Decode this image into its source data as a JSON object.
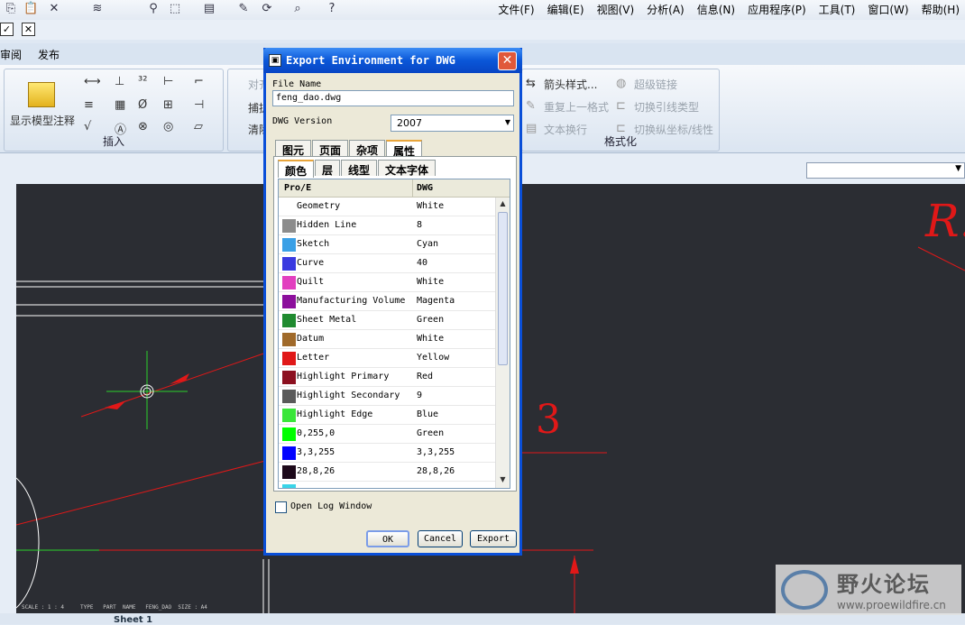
{
  "menubar": [
    "文件(F)",
    "编辑(E)",
    "视图(V)",
    "分析(A)",
    "信息(N)",
    "应用程序(P)",
    "工具(T)",
    "窗口(W)",
    "帮助(H)"
  ],
  "ribbon_tabs": [
    "审阅",
    "发布"
  ],
  "ribbon": {
    "big_button": "显示模型注释",
    "group_insert": "插入",
    "item_align": "对齐",
    "item_capture": "捕捉",
    "item_clear": "清除",
    "group_format": "格式化",
    "format_items": [
      "箭头样式...",
      "重复上一格式",
      "文本换行",
      "超级链接",
      "切换引线类型",
      "切换纵坐标/线性"
    ]
  },
  "dialog": {
    "title": "Export Environment for DWG",
    "file_name_label": "File Name",
    "file_name_value": "feng_dao.dwg",
    "dwg_version_label": "DWG Version",
    "dwg_version_value": "2007",
    "tabs": [
      "图元",
      "页面",
      "杂项",
      "属性"
    ],
    "active_tab": "属性",
    "subtabs": [
      "颜色",
      "层",
      "线型",
      "文本字体"
    ],
    "active_subtab": "颜色",
    "table_headers": [
      "Pro/E",
      "DWG"
    ],
    "rows": [
      {
        "name": "Geometry",
        "dwg": "White",
        "color": ""
      },
      {
        "name": "Hidden Line",
        "dwg": "8",
        "color": "#8c8c8c"
      },
      {
        "name": "Sketch",
        "dwg": "Cyan",
        "color": "#3aa0e6"
      },
      {
        "name": "Curve",
        "dwg": "40",
        "color": "#3a3ae0"
      },
      {
        "name": "Quilt",
        "dwg": "White",
        "color": "#e23fbf"
      },
      {
        "name": "Manufacturing Volume",
        "dwg": "Magenta",
        "color": "#8c0f9c"
      },
      {
        "name": "Sheet Metal",
        "dwg": "Green",
        "color": "#1f8a2f"
      },
      {
        "name": "Datum",
        "dwg": "White",
        "color": "#a06a2a"
      },
      {
        "name": "Letter",
        "dwg": "Yellow",
        "color": "#e01818"
      },
      {
        "name": "Highlight Primary",
        "dwg": "Red",
        "color": "#8c1020"
      },
      {
        "name": "Highlight Secondary",
        "dwg": "9",
        "color": "#5a5a5a"
      },
      {
        "name": "Highlight Edge",
        "dwg": "Blue",
        "color": "#3ae63a"
      },
      {
        "name": "0,255,0",
        "dwg": "Green",
        "color": "#00ff00"
      },
      {
        "name": "3,3,255",
        "dwg": "3,3,255",
        "color": "#0303ff"
      },
      {
        "name": "28,8,26",
        "dwg": "28,8,26",
        "color": "#1c081a"
      },
      {
        "name": "",
        "dwg": "",
        "color": "#39d4e8"
      }
    ],
    "open_log_label": "Open Log Window",
    "ok": "OK",
    "cancel": "Cancel",
    "export": "Export"
  },
  "canvas": {
    "dimension_3": "3",
    "partial_text_r": "R.",
    "status_line": "SCALE : 1 : 4     TYPE   PART  NAME   FENG_DAO  SIZE : A4",
    "sheet_tab": "Sheet 1"
  },
  "watermark": {
    "title": "野火论坛",
    "url": "www.proewildfire.cn"
  },
  "colors": {
    "accent": "#0a57d8",
    "canvas_bg": "#2b2d33",
    "annotation_red": "#e01818"
  }
}
